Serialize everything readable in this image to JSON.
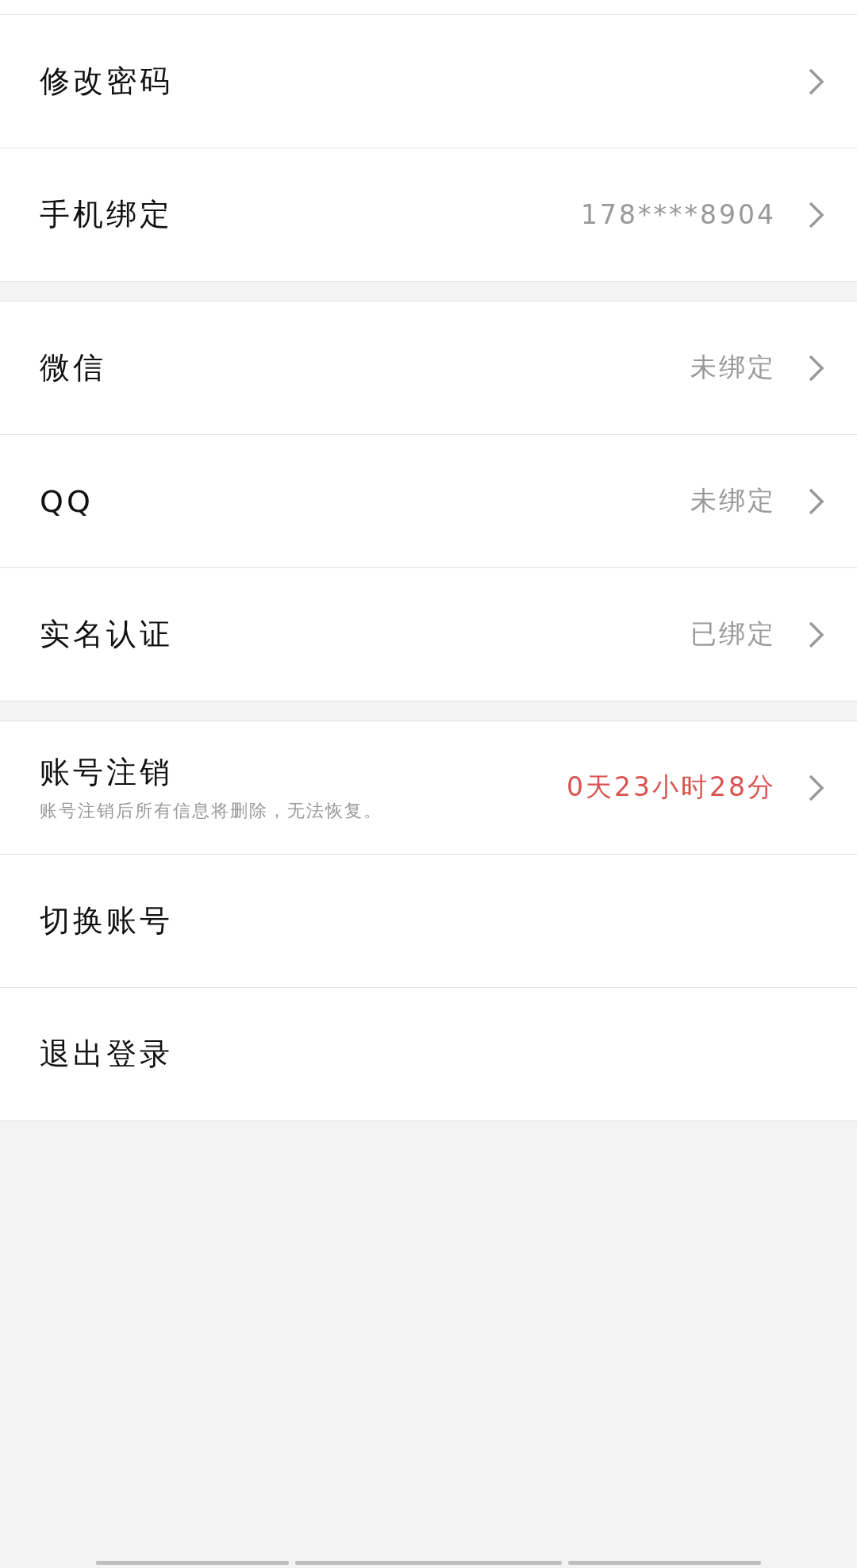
{
  "groups": [
    {
      "rows": [
        {
          "kind": "nav",
          "label": "修改密码"
        },
        {
          "kind": "nav",
          "label": "手机绑定",
          "value": "178****8904",
          "highlight": false
        }
      ]
    },
    {
      "rows": [
        {
          "kind": "nav",
          "label": "微信",
          "value": "未绑定",
          "highlight": false
        },
        {
          "kind": "nav",
          "label": "QQ",
          "value": "未绑定",
          "highlight": false
        },
        {
          "kind": "nav",
          "label": "实名认证",
          "value": "已绑定",
          "highlight": false
        }
      ]
    },
    {
      "rows": [
        {
          "kind": "nav",
          "label": "账号注销",
          "subtitle": "账号注销后所有信息将删除，无法恢复。",
          "value": "0天23小时28分",
          "highlight": true
        },
        {
          "kind": "action",
          "label": "切换账号"
        },
        {
          "kind": "action",
          "label": "退出登录"
        }
      ]
    }
  ]
}
